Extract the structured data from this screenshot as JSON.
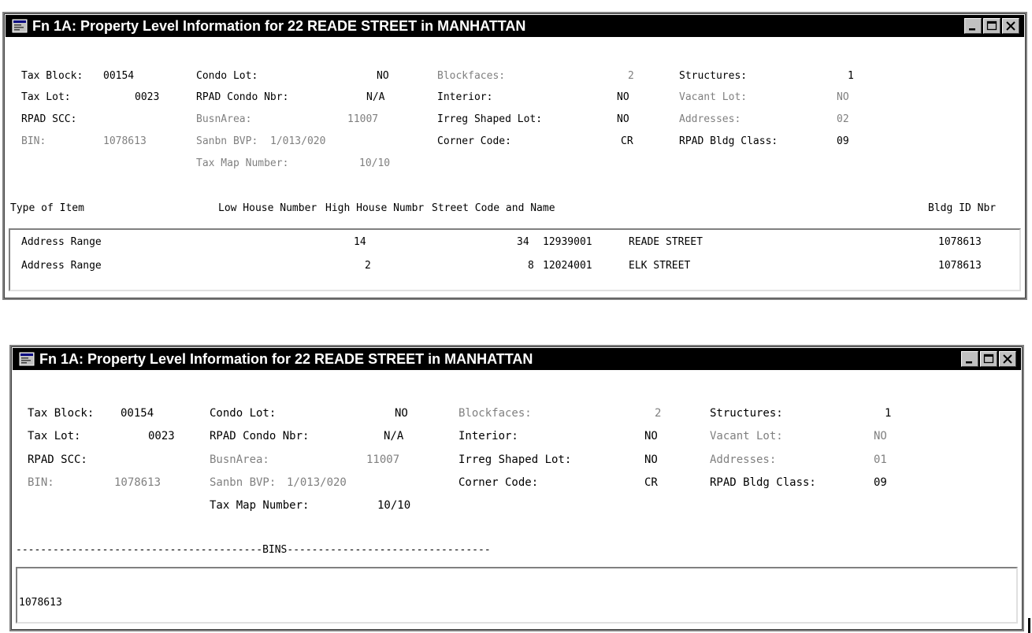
{
  "windows": [
    {
      "title": "Fn 1A: Property Level Information for 22 READE STREET in MANHATTAN",
      "fields": {
        "tax_block_label": "Tax Block:",
        "tax_block_value": "00154",
        "tax_lot_label": "Tax Lot:",
        "tax_lot_value": "0023",
        "rpad_scc_label": "RPAD SCC:",
        "bin_label": "BIN:",
        "bin_value": "1078613",
        "condo_lot_label": "Condo Lot:",
        "condo_lot_value": "NO",
        "rpad_condo_label": "RPAD Condo Nbr:",
        "rpad_condo_value": "N/A",
        "busnarea_label": "BusnArea:",
        "busnarea_value": "11007",
        "sanbn_label": "Sanbn BVP:",
        "sanbn_value": "1/013/020",
        "taxmap_label": "Tax Map Number:",
        "taxmap_value": "10/10",
        "blockfaces_label": "Blockfaces:",
        "blockfaces_value": "2",
        "interior_label": "Interior:",
        "interior_value": "NO",
        "irreg_label": "Irreg Shaped Lot:",
        "irreg_value": "NO",
        "corner_label": "Corner Code:",
        "corner_value": "CR",
        "structures_label": "Structures:",
        "structures_value": "1",
        "vacant_label": "Vacant Lot:",
        "vacant_value": "NO",
        "addresses_label": "Addresses:",
        "addresses_value": "02",
        "bldg_class_label": "RPAD Bldg Class:",
        "bldg_class_value": "09"
      },
      "headers": {
        "type": "Type of Item",
        "low": "Low House Number",
        "high": "High House Numbr",
        "street": "Street Code and Name",
        "bin": "Bldg ID Nbr"
      },
      "rows": [
        {
          "type": "Address Range",
          "low": "14",
          "high": "34",
          "code": "12939001",
          "street": "READE STREET",
          "bin": "1078613"
        },
        {
          "type": "Address Range",
          "low": "2",
          "high": "8",
          "code": "12024001",
          "street": "ELK STREET",
          "bin": "1078613"
        }
      ]
    },
    {
      "title": "Fn 1A: Property Level Information for 22 READE STREET in MANHATTAN",
      "fields": {
        "tax_block_label": "Tax Block:",
        "tax_block_value": "00154",
        "tax_lot_label": "Tax Lot:",
        "tax_lot_value": "0023",
        "rpad_scc_label": "RPAD SCC:",
        "bin_label": "BIN:",
        "bin_value": "1078613",
        "condo_lot_label": "Condo Lot:",
        "condo_lot_value": "NO",
        "rpad_condo_label": "RPAD Condo Nbr:",
        "rpad_condo_value": "N/A",
        "busnarea_label": "BusnArea:",
        "busnarea_value": "11007",
        "sanbn_label": "Sanbn BVP:",
        "sanbn_value": "1/013/020",
        "taxmap_label": "Tax Map Number:",
        "taxmap_value": "10/10",
        "blockfaces_label": "Blockfaces:",
        "blockfaces_value": "2",
        "interior_label": "Interior:",
        "interior_value": "NO",
        "irreg_label": "Irreg Shaped Lot:",
        "irreg_value": "NO",
        "corner_label": "Corner Code:",
        "corner_value": "CR",
        "structures_label": "Structures:",
        "structures_value": "1",
        "vacant_label": "Vacant Lot:",
        "vacant_value": "NO",
        "addresses_label": "Addresses:",
        "addresses_value": "01",
        "bldg_class_label": "RPAD Bldg Class:",
        "bldg_class_value": "09"
      },
      "bins_separator": "----------------------------------------BINS---------------------------------",
      "bins": [
        "1078613"
      ]
    }
  ],
  "icons": {
    "app": "app-window-icon",
    "minimize": "minimize-icon",
    "maximize": "maximize-icon",
    "close": "close-icon"
  }
}
